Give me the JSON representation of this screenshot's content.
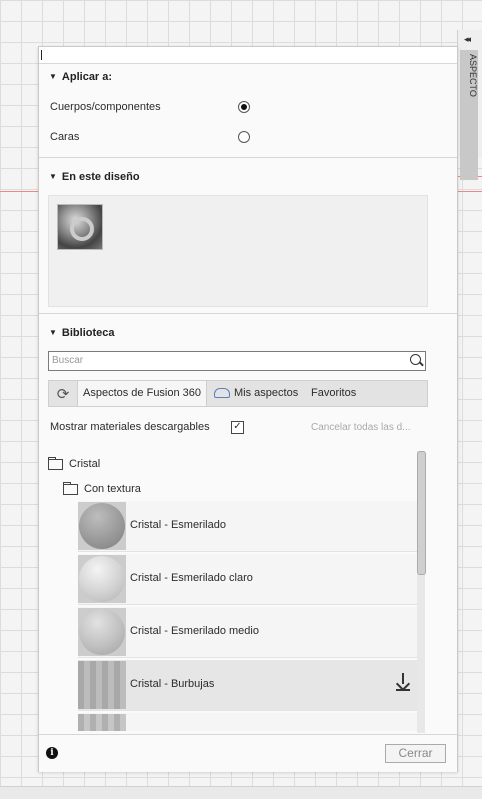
{
  "side_panel": {
    "label": "ASPECTO",
    "collapse_glyph": "◂◂"
  },
  "apply": {
    "heading": "Aplicar a:",
    "options": [
      {
        "label": "Cuerpos/componentes",
        "selected": true
      },
      {
        "label": "Caras",
        "selected": false
      }
    ]
  },
  "design": {
    "heading": "En este diseño",
    "items": [
      {
        "icon": "chrome-ring-material"
      }
    ]
  },
  "library": {
    "heading": "Biblioteca",
    "search_placeholder": "Buscar",
    "tabs": [
      {
        "label": "Aspectos de Fusion 360",
        "active": true
      },
      {
        "label": "Mis aspectos",
        "icon": "cloud-icon"
      },
      {
        "label": "Favoritos"
      }
    ],
    "show_downloadable_label": "Mostrar materiales descargables",
    "show_downloadable_checked": true,
    "cancel_all_label": "Cancelar todas las d...",
    "tree": {
      "folder": "Cristal",
      "subfolder": "Con textura",
      "items": [
        {
          "label": "Cristal - Esmerilado",
          "downloadable": false
        },
        {
          "label": "Cristal - Esmerilado claro",
          "downloadable": false
        },
        {
          "label": "Cristal - Esmerilado medio",
          "downloadable": false
        },
        {
          "label": "Cristal - Burbujas",
          "downloadable": true
        }
      ]
    }
  },
  "footer": {
    "info_glyph": "i",
    "close_label": "Cerrar"
  }
}
